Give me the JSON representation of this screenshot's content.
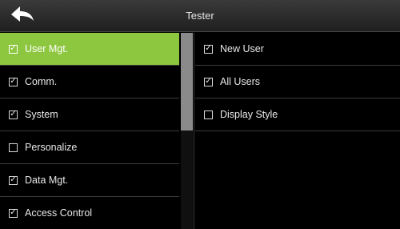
{
  "header": {
    "title": "Tester",
    "back_icon": "arrow-back-icon"
  },
  "colors": {
    "selected_bg": "#8dc63f",
    "background": "#000000",
    "scroll_thumb": "#8a8a8a"
  },
  "left_menu": {
    "items": [
      {
        "label": "User Mgt.",
        "checked": true,
        "selected": true
      },
      {
        "label": "Comm.",
        "checked": true,
        "selected": false
      },
      {
        "label": "System",
        "checked": true,
        "selected": false
      },
      {
        "label": "Personalize",
        "checked": false,
        "selected": false
      },
      {
        "label": "Data Mgt.",
        "checked": true,
        "selected": false
      },
      {
        "label": "Access Control",
        "checked": true,
        "selected": false
      }
    ]
  },
  "right_menu": {
    "items": [
      {
        "label": "New User",
        "checked": true
      },
      {
        "label": "All Users",
        "checked": true
      },
      {
        "label": "Display Style",
        "checked": false
      }
    ]
  }
}
